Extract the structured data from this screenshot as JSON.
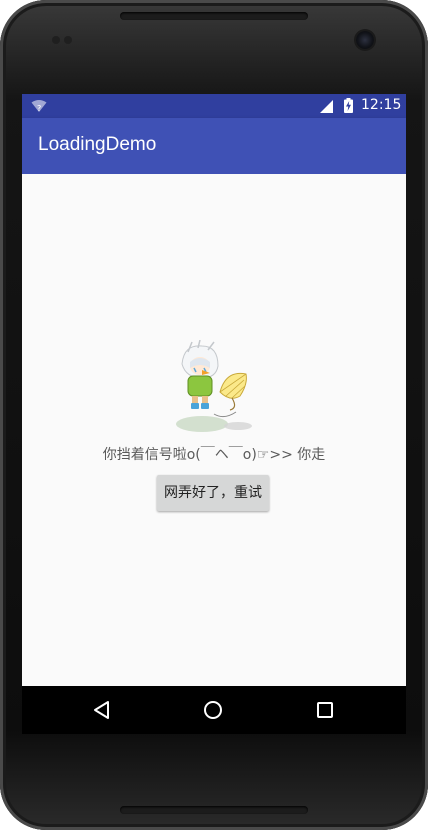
{
  "status_bar": {
    "time": "12:15",
    "wifi_icon": "wifi-unknown-icon",
    "signal_icon": "signal-icon",
    "battery_icon": "battery-charging-icon"
  },
  "app_bar": {
    "title": "LoadingDemo"
  },
  "error_state": {
    "illustration": "girl-with-umbrella-illustration",
    "message": "你挡着信号啦o(￣ヘ￣o)☞>> 你走",
    "retry_label": "网弄好了，重试"
  },
  "nav_bar": {
    "back_icon": "back-icon",
    "home_icon": "home-icon",
    "recents_icon": "recents-icon"
  },
  "colors": {
    "primary": "#3f51b5",
    "primary_dark": "#303f9f",
    "background": "#fafafa",
    "button": "#d6d7d7"
  }
}
